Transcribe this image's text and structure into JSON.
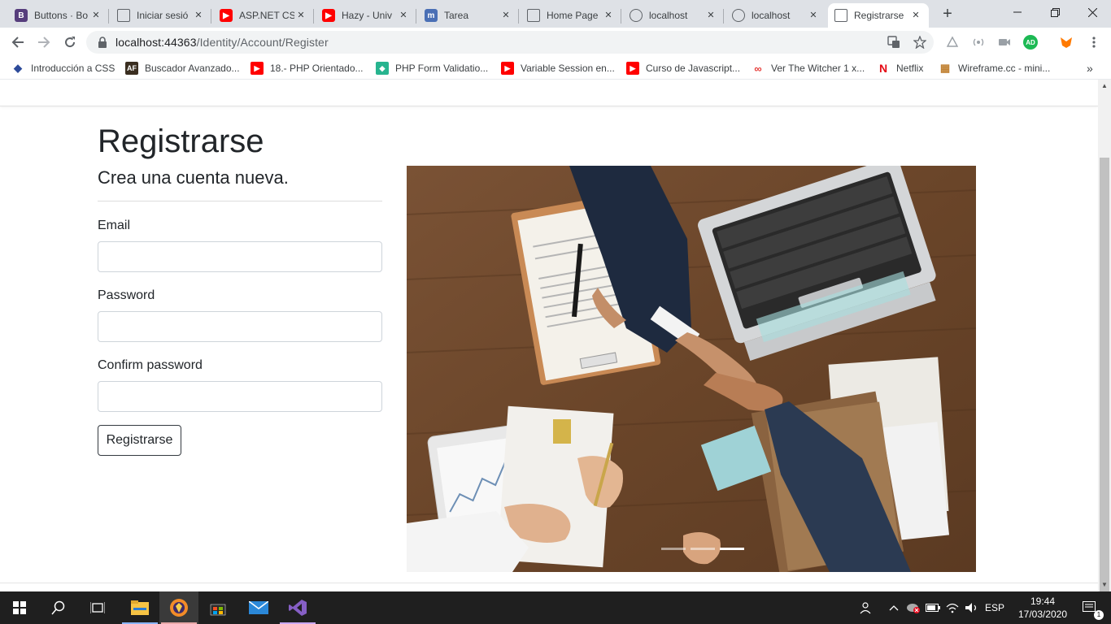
{
  "browser": {
    "tabs": [
      {
        "title": "Buttons · Bo",
        "icon": "bootstrap-icon",
        "color": "#563d7c",
        "glyph": "B"
      },
      {
        "title": "Iniciar sesió",
        "icon": "page-icon",
        "color": "#5f6368",
        "glyph": ""
      },
      {
        "title": "ASP.NET CS",
        "icon": "youtube-icon",
        "color": "#ff0000",
        "glyph": "▶"
      },
      {
        "title": "Hazy - Univ",
        "icon": "youtube-icon",
        "color": "#ff0000",
        "glyph": "▶"
      },
      {
        "title": "Tarea",
        "icon": "moodle-icon",
        "color": "#4a6fb5",
        "glyph": "m"
      },
      {
        "title": "Home Page",
        "icon": "page-icon",
        "color": "#5f6368",
        "glyph": ""
      },
      {
        "title": "localhost",
        "icon": "globe-icon",
        "color": "#5f6368",
        "glyph": ""
      },
      {
        "title": "localhost",
        "icon": "globe-icon",
        "color": "#5f6368",
        "glyph": ""
      },
      {
        "title": "Registrarse",
        "icon": "page-icon",
        "color": "#5f6368",
        "glyph": ""
      }
    ],
    "active_tab": 8,
    "url_host": "localhost:44363",
    "url_path": "/Identity/Account/Register",
    "bookmarks": [
      {
        "label": "Introducción a CSS",
        "icon": "css-icon",
        "color": "#2d4b9a",
        "glyph": "◆"
      },
      {
        "label": "Buscador Avanzado...",
        "icon": "af-icon",
        "color": "#3a2e20",
        "glyph": "AF"
      },
      {
        "label": "18.- PHP Orientado...",
        "icon": "youtube-icon",
        "color": "#ff0000",
        "glyph": "▶"
      },
      {
        "label": "PHP Form Validatio...",
        "icon": "shield-icon",
        "color": "#27b48f",
        "glyph": "◆"
      },
      {
        "label": "Variable Session en...",
        "icon": "youtube-icon",
        "color": "#ff0000",
        "glyph": "▶"
      },
      {
        "label": "Curso de Javascript...",
        "icon": "youtube-icon",
        "color": "#ff0000",
        "glyph": "▶"
      },
      {
        "label": "Ver The Witcher 1 x...",
        "icon": "infinity-icon",
        "color": "#e53935",
        "glyph": "∞"
      },
      {
        "label": "Netflix",
        "icon": "netflix-icon",
        "color": "#e50914",
        "glyph": "N"
      },
      {
        "label": "Wireframe.cc - mini...",
        "icon": "wireframe-icon",
        "color": "#c08030",
        "glyph": "▦"
      }
    ],
    "profile_initials": "AD"
  },
  "page": {
    "title": "Registrarse",
    "subtitle": "Crea una cuenta nueva.",
    "email_label": "Email",
    "password_label": "Password",
    "confirm_label": "Confirm password",
    "submit_label": "Registrarse",
    "carousel": {
      "slides": 3,
      "active": 2
    }
  },
  "taskbar": {
    "language": "ESP",
    "time": "19:44",
    "date": "17/03/2020",
    "notifications": "1"
  }
}
